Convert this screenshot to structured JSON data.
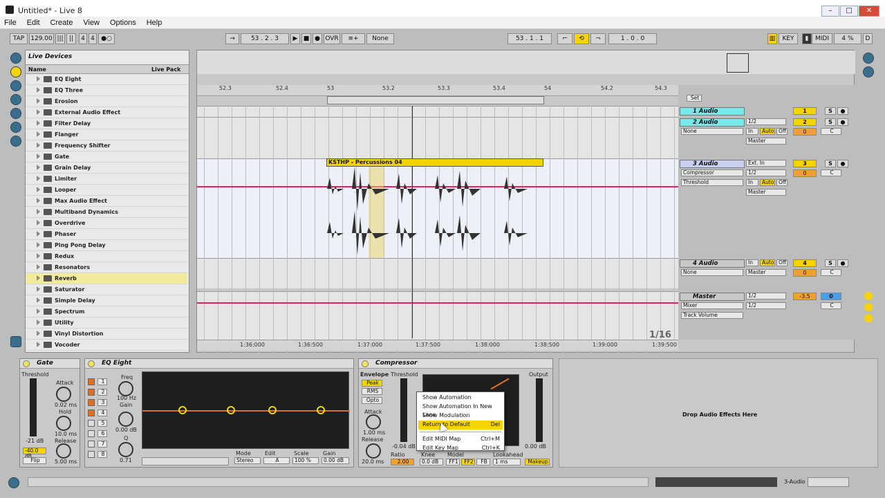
{
  "window": {
    "title": "Untitled* - Live 8"
  },
  "menu": [
    "File",
    "Edit",
    "Create",
    "View",
    "Options",
    "Help"
  ],
  "transport": {
    "tap": "TAP",
    "tempo": "129.00",
    "sig_num": "4",
    "sig_den": "4",
    "position": "53 .  2 .  3",
    "ovr": "OVR",
    "quant": "None",
    "arr_pos": "53 .  1 .  1",
    "loop_len": "1 .  0 .  0",
    "key": "KEY",
    "midi": "MIDI",
    "cpu": "4 %",
    "disk": "D"
  },
  "browser": {
    "title": "Live Devices",
    "col_name": "Name",
    "col_pack": "Live Pack",
    "items": [
      "EQ Eight",
      "EQ Three",
      "Erosion",
      "External Audio Effect",
      "Filter Delay",
      "Flanger",
      "Frequency Shifter",
      "Gate",
      "Grain Delay",
      "Limiter",
      "Looper",
      "Max Audio Effect",
      "Multiband Dynamics",
      "Overdrive",
      "Phaser",
      "Ping Pong Delay",
      "Redux",
      "Resonators",
      "Reverb",
      "Saturator",
      "Simple Delay",
      "Spectrum",
      "Utility",
      "Vinyl Distortion",
      "Vocoder"
    ],
    "selected": "Reverb"
  },
  "ruler": [
    "52.3",
    "52.4",
    "53",
    "53.2",
    "53.3",
    "53.4",
    "54",
    "54.2",
    "54.3"
  ],
  "timeline": [
    "1:36:000",
    "1:36:500",
    "1:37:000",
    "1:37:500",
    "1:38:000",
    "1:38:500",
    "1:39:000",
    "1:39:500"
  ],
  "grid": "1/16",
  "set_label": "Set",
  "clip": {
    "name": "KSTHP - Percussions 04"
  },
  "tracks": [
    {
      "name": "1 Audio",
      "num": "1"
    },
    {
      "name": "2 Audio",
      "num": "2",
      "device": "None",
      "in": "In",
      "auto": "Auto",
      "off": "Off",
      "out": "Master",
      "vol": "0",
      "pan": "C",
      "input": "1/2"
    },
    {
      "name": "3 Audio",
      "num": "3",
      "device": "Compressor",
      "param": "Threshold",
      "in_type": "Ext. In",
      "input": "1/2",
      "in": "In",
      "auto": "Auto",
      "off": "Off",
      "out": "Master",
      "vol": "0",
      "pan": "C"
    },
    {
      "name": "4 Audio",
      "num": "4",
      "device": "None",
      "in": "In",
      "auto": "Auto",
      "off": "Off",
      "out": "Master",
      "vol": "0",
      "pan": "C"
    },
    {
      "name": "Master",
      "device": "Mixer",
      "param": "Track Volume",
      "input": "1/2",
      "output": "1/2",
      "vol": "-3.5",
      "num": "0",
      "pan": "C"
    }
  ],
  "gate": {
    "title": "Gate",
    "threshold": "Threshold",
    "attack_lbl": "Attack",
    "attack": "0.02 ms",
    "hold_lbl": "Hold",
    "hold": "10.0 ms",
    "release_lbl": "Release",
    "release": "5.00 ms",
    "db": "-21 dB",
    "range": "-40.0 dB",
    "flip": "Flip"
  },
  "eq": {
    "title": "EQ Eight",
    "freq_lbl": "Freq",
    "freq": "100 Hz",
    "gain_lbl": "Gain",
    "gain": "0.00 dB",
    "q_lbl": "Q",
    "q": "0.71",
    "bands": [
      "1",
      "2",
      "3",
      "4",
      "5",
      "6",
      "7",
      "8"
    ],
    "mode_lbl": "Mode",
    "mode": "Stereo",
    "edit_lbl": "Edit",
    "edit": "A",
    "scale_lbl": "Scale",
    "scale": "100 %",
    "gain2_lbl": "Gain",
    "gain2": "0.00 dB"
  },
  "comp": {
    "title": "Compressor",
    "envelope": "Envelope",
    "peak": "Peak",
    "rms": "RMS",
    "opto": "Opto",
    "threshold_lbl": "Threshold",
    "attack_lbl": "Attack",
    "attack": "1.00 ms",
    "release_lbl": "Release",
    "release": "20.0 ms",
    "ratio_lbl": "Ratio",
    "ratio": "2.00",
    "knee_lbl": "Knee",
    "knee": "0.0 dB",
    "model_lbl": "Model",
    "ff1": "FF1",
    "ff2": "FF2",
    "fb": "FB",
    "look_lbl": "Lookahead",
    "look": "1 ms",
    "output_lbl": "Output",
    "output": "0.00 dB",
    "makeup": "Makeup",
    "thr_db": "-0.04 dB"
  },
  "context": [
    {
      "label": "Show Automation",
      "sc": ""
    },
    {
      "label": "Show Automation In New Lane",
      "sc": ""
    },
    {
      "label": "Show Modulation",
      "sc": ""
    },
    {
      "label": "Return to Default",
      "sc": "Del"
    },
    {
      "label": "Edit MIDI Map",
      "sc": "Ctrl+M"
    },
    {
      "label": "Edit Key Map",
      "sc": "Ctrl+K"
    }
  ],
  "dropzone": "Drop Audio Effects Here",
  "status": {
    "track": "3-Audio"
  }
}
